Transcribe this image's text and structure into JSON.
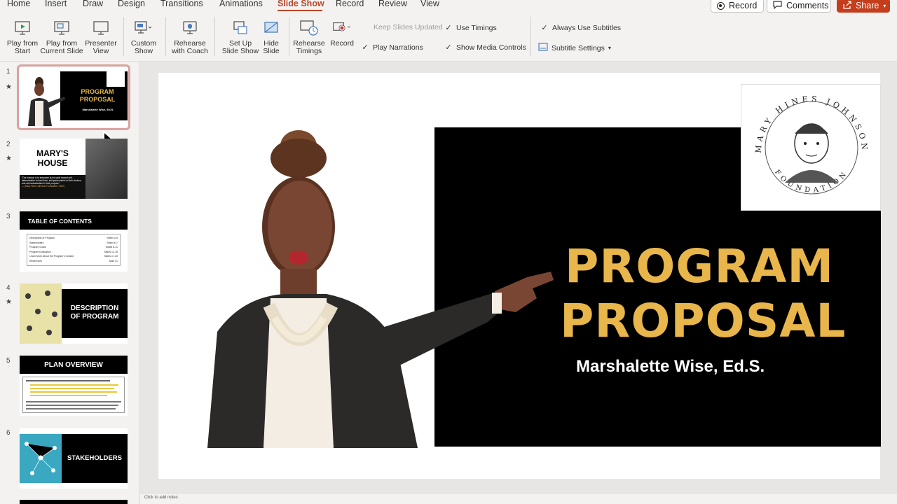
{
  "ribbon_tabs": {
    "items": [
      "Home",
      "Insert",
      "Draw",
      "Design",
      "Transitions",
      "Animations",
      "Slide Show",
      "Record",
      "Review",
      "View"
    ],
    "active": "Slide Show"
  },
  "top_actions": {
    "record": "Record",
    "comments": "Comments",
    "share": "Share"
  },
  "toolbar": {
    "play_from_start": "Play from\nStart",
    "play_from_current": "Play from\nCurrent Slide",
    "presenter_view": "Presenter\nView",
    "custom_show": "Custom\nShow",
    "rehearse_coach": "Rehearse\nwith Coach",
    "setup_show": "Set Up\nSlide Show",
    "hide_slide": "Hide\nSlide",
    "rehearse_timings": "Rehearse\nTimings",
    "record": "Record",
    "keep_updated": "Keep Slides Updated",
    "play_narrations": "Play Narrations",
    "use_timings": "Use Timings",
    "show_media_controls": "Show Media Controls",
    "always_subtitles": "Always Use Subtitles",
    "subtitle_settings": "Subtitle Settings"
  },
  "slides_panel": {
    "thumbs": [
      {
        "num": "1",
        "star": true,
        "title_a": "PROGRAM",
        "title_b": "PROPOSAL",
        "sub": "Marshalette Wise, Ed.S."
      },
      {
        "num": "2",
        "star": true,
        "title_a": "MARY'S",
        "title_b": "HOUSE",
        "quote": "\"Our mission is to empower at-risk girls toward self-determination in their lives, self-preservation in their choices, and self-actualization in their purpose.\"",
        "attrib": "— (Mary Hines Johnson Foundation, 2022)"
      },
      {
        "num": "3",
        "star": false,
        "title": "TABLE OF CONTENTS",
        "rows": [
          [
            "Description of Program",
            "Slides 4-5"
          ],
          [
            "Stakeholders",
            "Slides 6-7"
          ],
          [
            "Program Goals",
            "Slides 8-11"
          ],
          [
            "Program Evaluation",
            "Slides 12-15"
          ],
          [
            "Learn More About the Program's Creator",
            "Slides 17-20"
          ],
          [
            "References",
            "Slide 21"
          ]
        ]
      },
      {
        "num": "4",
        "star": true,
        "title_a": "DESCRIPTION",
        "title_b": "OF PROGRAM"
      },
      {
        "num": "5",
        "star": false,
        "title": "PLAN OVERVIEW"
      },
      {
        "num": "6",
        "star": false,
        "title": "STAKEHOLDERS"
      }
    ]
  },
  "slide": {
    "title_line1": "PROGRAM",
    "title_line2": "PROPOSAL",
    "presenter": "Marshalette Wise, Ed.S.",
    "logo_ring_top": "MARY HINES JOHNSON",
    "logo_ring_bottom": "FOUNDATION"
  },
  "status_bar": {
    "notes_hint": "Click to add notes"
  },
  "colors": {
    "accent": "#b7472a",
    "title_gold": "#e8b64a",
    "share_red": "#c43e1c"
  }
}
